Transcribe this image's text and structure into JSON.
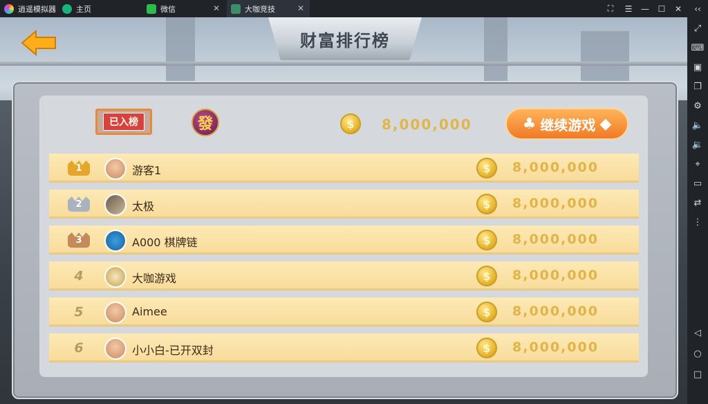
{
  "emulator": {
    "app_title": "逍遥模拟器",
    "tabs": [
      {
        "label": "主页"
      },
      {
        "label": "微信"
      },
      {
        "label": "大咖竞技"
      }
    ]
  },
  "game": {
    "title": "财富排行榜",
    "my_rank_badge": "已入榜",
    "my_icon_text": "發",
    "my_coins": "8,000,000",
    "continue_label": "继续游戏",
    "coin_symbol": "$",
    "rows": [
      {
        "rank": "1",
        "name": "游客1",
        "coins": "8,000,000"
      },
      {
        "rank": "2",
        "name": "太极",
        "coins": "8,000,000"
      },
      {
        "rank": "3",
        "name": "A000 棋牌链",
        "coins": "8,000,000"
      },
      {
        "rank": "4",
        "name": "大咖游戏",
        "coins": "8,000,000"
      },
      {
        "rank": "5",
        "name": "Aimee",
        "coins": "8,000,000"
      },
      {
        "rank": "6",
        "name": "小小白-已开双封",
        "coins": "8,000,000"
      }
    ]
  },
  "colors": {
    "gold_text": "#e1b44a",
    "row_bg": "#fde9b5",
    "continue_btn": "#f07a26"
  }
}
